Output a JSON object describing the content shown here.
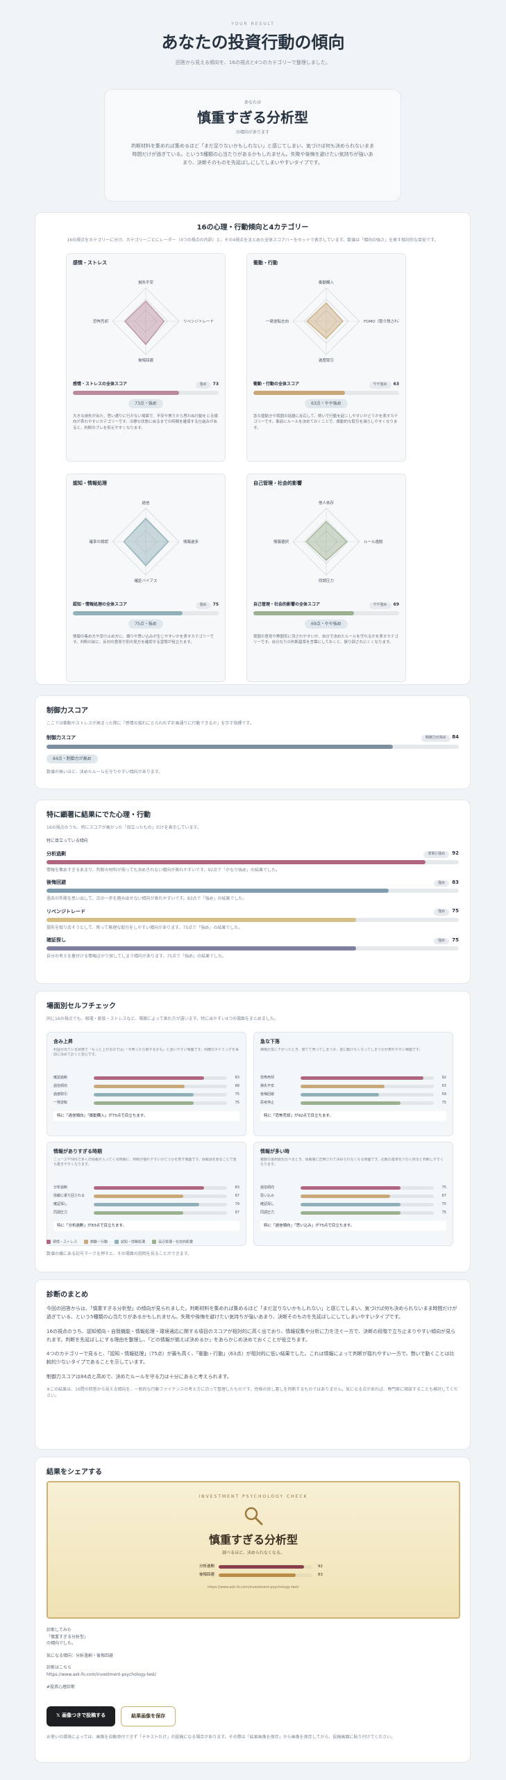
{
  "header": {
    "eyebrow": "YOUR RESULT",
    "title": "あなたの投資行動の傾向",
    "subtitle": "回答から見える傾向を、16の視点と4つのカテゴリーで整理しました。"
  },
  "result": {
    "small": "あなたは",
    "type": "慎重すぎる分析型",
    "note": "の傾向があります",
    "desc": "判断材料を集めれば集めるほど「まだ足りないかもしれない」と感じてしまい、気づけば何も決められないまま時間だけが過ぎている。という5種類の心当たりがあるかもしれません。失敗や後悔を避けたい気持ちが強いあまり、決断そのものを先延ばしにしてしまいやすいタイプです。"
  },
  "categories": {
    "title": "16の心理・行動傾向と4カテゴリー",
    "intro": "16の視点をカテゴリーに分け、カテゴリーごとにレーダー（4つの視点の内訳）と、その4視点をまとめた全体スコアバーをセットで表示しています。数値は「傾向の強さ」を表す相対的な目安です。",
    "items": [
      {
        "name": "感情・ストレス",
        "axes": [
          "損失不安",
          "リベンジトレード",
          "後悔回避",
          "恐怖売却"
        ],
        "score_label": "感情・ストレスの全体スコア",
        "badge": "強め",
        "score": 73,
        "color": "#b88a9c",
        "pill": "73点・強め",
        "radar": [
          0.6,
          0.55,
          0.7,
          0.62
        ],
        "desc": "大きな損失が出た、思い通りに行かない場面で、不安や焦りから思わぬ行動をとる傾向が表れやすいカテゴリーです。冷静な状態に戻るまでの時間を確保する仕組みがあると、判断のブレを抑えやすくなります。"
      },
      {
        "name": "衝動・行動",
        "axes": [
          "衝動購入",
          "FOMO（取り残され不安）",
          "過度取引",
          "一発逆転志向"
        ],
        "score_label": "衝動・行動の全体スコア",
        "badge": "やや強め",
        "score": 63,
        "color": "#c8a878",
        "pill": "63点・やや強め",
        "radar": [
          0.55,
          0.5,
          0.52,
          0.58
        ],
        "desc": "急な値動きや周囲の話題に反応して、勢いで行動を起こしやすいかどうかを表すカテゴリーです。事前にルールを決めておくことで、衝動的な取引を減らしやすくなります。"
      },
      {
        "name": "認知・情報処理",
        "axes": [
          "過信",
          "情報過多",
          "確証バイアス",
          "確率の誤認"
        ],
        "score_label": "認知・情報処理の全体スコア",
        "badge": "強め",
        "score": 75,
        "color": "#8fb0b8",
        "pill": "75点・強め",
        "radar": [
          0.7,
          0.68,
          0.72,
          0.66
        ],
        "desc": "情報の集め方や受け止め方に、偏りや思い込みが生じやすいかを表すカテゴリーです。判断の前に、反対の意見や別の見方を確認する習慣が役立ちます。"
      },
      {
        "name": "自己管理・社会的影響",
        "axes": [
          "他人依存",
          "ルール逸脱",
          "同調圧力",
          "情報選択"
        ],
        "score_label": "自己管理・社会的影響の全体スコア",
        "badge": "やや強め",
        "score": 69,
        "color": "#9bb08e",
        "pill": "69点・やや強め",
        "radar": [
          0.6,
          0.62,
          0.56,
          0.6
        ],
        "desc": "周囲の意見や雰囲気に流されやすいか、自分で決めたルールを守れるかを表すカテゴリーです。自分なりの判断基準を言葉にしておくと、振り回されにくくなります。"
      }
    ]
  },
  "control": {
    "title": "制御力スコア",
    "intro": "ここでは衝動やストレスが高まった際に「感情の揺れにとらわれず計画通りに行動できるか」を示す指標です。",
    "label": "制御力スコア",
    "badge": "制御力が高め",
    "score": 84,
    "pill": "84点・制御力が高め",
    "note": "数値が高いほど、決めたルールを守りやすい傾向があります。"
  },
  "strong": {
    "title": "特に顕著に結果にでた心理・行動",
    "intro": "16の視点のうち、特にスコアが高かった「目立ったもの」だけを表示しています。",
    "sub": "特に目立っている傾向",
    "items": [
      {
        "name": "分析過剰",
        "badge": "非常に強め",
        "score": 92,
        "color": "#b0667e",
        "desc": "情報を集めすぎるあまり、判断の材料が揃っても決めきれない傾向が表れやすいです。92点で「かなり強め」の結果でした。"
      },
      {
        "name": "後悔回避",
        "badge": "強め",
        "score": 83,
        "color": "#7f9dae",
        "desc": "過去の失敗を思い出して、次の一歩を踏み出せない傾向が表れやすいです。83点で「強め」の結果でした。"
      },
      {
        "name": "リベンジトレード",
        "badge": "強め",
        "score": 75,
        "color": "#d6bf87",
        "desc": "損失を取り戻そうとして、焦って無理な取引をしやすい傾向があります。75点で「強め」の結果でした。"
      },
      {
        "name": "確証探し",
        "badge": "強め",
        "score": 75,
        "color": "#7e7e9e",
        "desc": "自分の考えを裏付ける情報ばかり探してしまう傾向があります。75点で「強め」の結果でした。"
      }
    ]
  },
  "scenes": {
    "title": "場面別セルフチェック",
    "intro": "同じ16の視点でも、相場・家族・ストレスなど、場面によって表れ方が違います。特に出やすい4つの場面をまとめました。",
    "items": [
      {
        "name": "含み上昇",
        "desc": "利益が出ている状態で「もっと上がるのでは」「今売ったら損するかも」と迷いやすい場面です。利確のタイミングを事前に決めておくと安心です。",
        "rows": [
          [
            "確認過剰",
            83,
            "#b0667e"
          ],
          [
            "過信傾向",
            68,
            "#c8a878"
          ],
          [
            "過度取引",
            75,
            "#8fb0b8"
          ],
          [
            "一発逆転",
            75,
            "#9bb08e"
          ]
        ],
        "sum": "特に「過信傾向」「衝動購入」が75点で目立ちます。"
      },
      {
        "name": "急な下落",
        "desc": "価格が急に下がったとき、慌てて売ってしまうか、逆に動けなくなってしまうかが表れやすい場面です。",
        "rows": [
          [
            "恐怖売却",
            92,
            "#b0667e"
          ],
          [
            "損失不安",
            63,
            "#c8a878"
          ],
          [
            "後悔回避",
            59,
            "#8fb0b8"
          ],
          [
            "思考停止",
            75,
            "#9bb08e"
          ]
        ],
        "sum": "特に「恐怖売却」が92点で目立ちます。"
      },
      {
        "name": "情報がありすぎる時期",
        "desc": "ニュースやSNSで多くの情報が入ってくる時期に、判断が揺れやすいかどうかを表す場面です。情報源を絞ることで落ち着きやすくなります。",
        "rows": [
          [
            "分析過剰",
            83,
            "#b0667e"
          ],
          [
            "情報に振り回される",
            67,
            "#c8a878"
          ],
          [
            "確証探し",
            79,
            "#8fb0b8"
          ],
          [
            "同調圧力",
            67,
            "#9bb08e"
          ]
        ],
        "sum": "特に「分析過剰」が83点で目立ちます。"
      },
      {
        "name": "情報が多い時",
        "desc": "複数の選択肢を比べるとき、情報量に圧倒されて決められなくなる場面です。比較の基準を少なく絞ると判断しやすくなります。",
        "rows": [
          [
            "過信傾向",
            75,
            "#b0667e"
          ],
          [
            "思い込み",
            67,
            "#c8a878"
          ],
          [
            "確証探し",
            75,
            "#8fb0b8"
          ],
          [
            "同調圧力",
            75,
            "#9bb08e"
          ]
        ],
        "sum": "特に「過信傾向」「思い込み」が75点で目立ちます。"
      }
    ],
    "legend": [
      "感情・ストレス",
      "衝動・行動",
      "認知・情報処理",
      "自己管理・社会的影響"
    ],
    "legend_colors": [
      "#b0667e",
      "#c8a878",
      "#8fb0b8",
      "#9bb08e"
    ],
    "foot": "数値の横にある記号マークを押すと、その場面の説明を見ることができます。"
  },
  "summary": {
    "title": "診断のまとめ",
    "p1": "今回の回答からは、「慎重すぎる分析型」の傾向が見られました。判断材料を集めれば集めるほど「まだ足りないかもしれない」と感じてしまい、気づけば何も決められないまま時間だけが過ぎている、という5種類の心当たりがあるかもしれません。失敗や後悔を避けたい気持ちが強いあまり、決断そのものを先延ばしにしてしまいやすいタイプです。",
    "p2": "16の視点のうち、認知傾向・自我機能・情報処理・環境適応に関する項目のスコアが相対的に高く出ており、情報収集や分析に力を注ぐ一方で、決断の段階で立ち止まりやすい傾向が見られます。判断を先延ばしにする理由を整理し、「どの情報が揃えば決めるか」をあらかじめ決めておくことが役立ちます。",
    "p3": "4つのカテゴリーで見ると、「認知・情報処理」（75点）が最も高く、「衝動・行動」（63点）が相対的に低い結果でした。これは情報によって判断が揺れやすい一方で、勢いで動くことは比較的少ないタイプであることを示しています。",
    "p4": "制御力スコアは84点と高めで、決めたルールを守る力は十分にあると考えられます。",
    "p5": "※この結果は、16問の回答から見える傾向を、一般的な行動ファイナンスの考え方に沿って整理したものです。性格の良し悪しを判断するものではありません。気になる点があれば、専門家に相談することも検討してください。"
  },
  "share": {
    "title": "結果をシェアする",
    "card_eyebrow": "INVESTMENT PSYCHOLOGY CHECK",
    "card_type": "慎重すぎる分析型",
    "card_sub": "調べるほど、決められなくなる。",
    "rows": [
      [
        "分析過剰",
        92
      ],
      [
        "後悔回避",
        83
      ]
    ],
    "url": "https://www.ask-fo.com/investment-psychology-test/",
    "t1": "診断してみた",
    "t2": "「慎重すぎる分析型」",
    "t3": "の傾向でした。",
    "t4": "気になる傾向：分析過剰・後悔回避",
    "t5": "診断はこちら",
    "t6": "https://www.ask-fo.com/investment-psychology-test/",
    "t7": "#投資心理診断",
    "post_btn": "𝕏 画像つきで投稿する",
    "save_btn": "結果画像を保存",
    "foot": "お使いの環境によっては、画像を自動添付できず「テキストだけ」の投稿になる場合があります。その際は「結果画像を保存」から画像を保存してから、投稿画面に貼り付けてください。"
  }
}
